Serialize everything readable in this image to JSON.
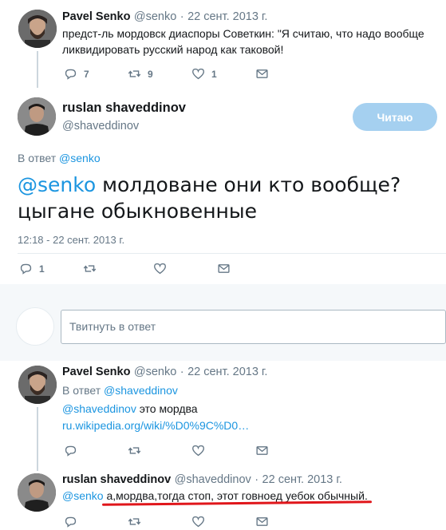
{
  "tweet1": {
    "name": "Pavel Senko",
    "handle": "@senko",
    "sep": "·",
    "date": "22 сент. 2013 г.",
    "text": "предст-ль мордовск диаспоры Советкин: \"Я считаю, что надо вообще ликвидировать русский народ как таковой!",
    "replies": "7",
    "retweets": "9",
    "likes": "1"
  },
  "main_tweet": {
    "name": "ruslan shaveddinov",
    "handle": "@shaveddinov",
    "follow_label": "Читаю",
    "reply_to_prefix": "В ответ",
    "reply_to_handle": "@senko",
    "mention": "@senko",
    "text": " молдоване они кто вообще?цыгане обыкновенные",
    "timestamp": "12:18 - 22 сент. 2013 г.",
    "replies": "1"
  },
  "reply_box": {
    "placeholder": "Твитнуть в ответ"
  },
  "tweet3": {
    "name": "Pavel Senko",
    "handle": "@senko",
    "sep": "·",
    "date": "22 сент. 2013 г.",
    "reply_to_prefix": "В ответ",
    "reply_to_handle": "@shaveddinov",
    "mention": "@shaveddinov",
    "text": " это мордва",
    "url": "ru.wikipedia.org/wiki/%D0%9C%D0…"
  },
  "tweet4": {
    "name": "ruslan shaveddinov",
    "handle": "@shaveddinov",
    "sep": "·",
    "date": "22 сент. 2013 г.",
    "mention": "@senko",
    "text": " а,мордва,тогда стоп, этот говноед уебок обычный",
    "text_end": "."
  },
  "colors": {
    "link": "#1b95e0",
    "muted": "#657786",
    "follow_button": "#a5d0f0",
    "underline": "#e0161b"
  }
}
